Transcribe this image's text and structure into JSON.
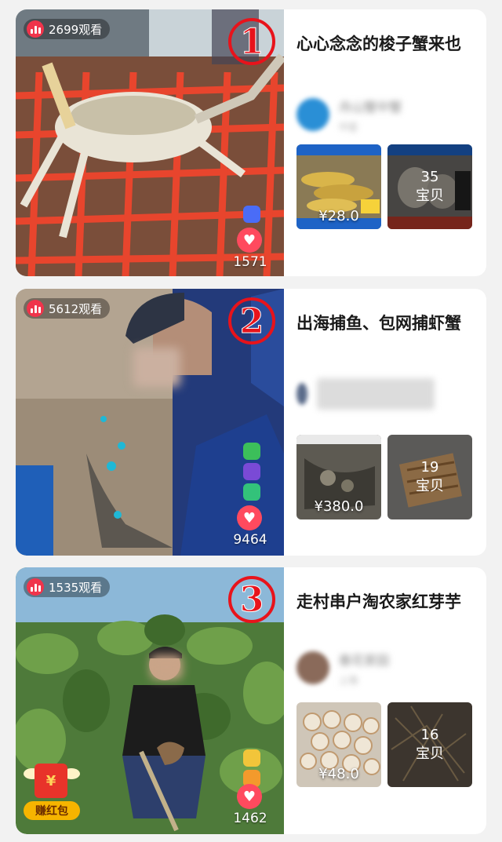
{
  "cards": [
    {
      "views": "2699观看",
      "rank": "1",
      "likes": "1571",
      "title": "心心念念的梭子蟹来也",
      "shop": {
        "name": "舟山蟹中蟹",
        "sub": "中宣"
      },
      "product_a": {
        "price": "¥28.0"
      },
      "product_b": {
        "count": "35",
        "count_label": "宝贝"
      }
    },
    {
      "views": "5612观看",
      "rank": "2",
      "likes": "9464",
      "title": "出海捕鱼、包网捕虾蟹",
      "product_a": {
        "price": "¥380.0"
      },
      "product_b": {
        "count": "19",
        "count_label": "宝贝"
      }
    },
    {
      "views": "1535观看",
      "rank": "3",
      "likes": "1462",
      "title": "走村串户淘农家红芽芋",
      "shop": {
        "name": "春花家园",
        "sub": "上海"
      },
      "red_packet_label": "赚红包",
      "product_a": {
        "price": "¥48.0"
      },
      "product_b": {
        "count": "16",
        "count_label": "宝贝"
      }
    }
  ],
  "icons": {
    "views": "bar-chart-icon",
    "like": "heart-icon",
    "red_packet": "red-envelope-icon"
  },
  "colors": {
    "accent_red": "#f0344b",
    "rank_red": "#e8131b",
    "card_bg": "#ffffff",
    "page_bg": "#f2f2f2"
  }
}
